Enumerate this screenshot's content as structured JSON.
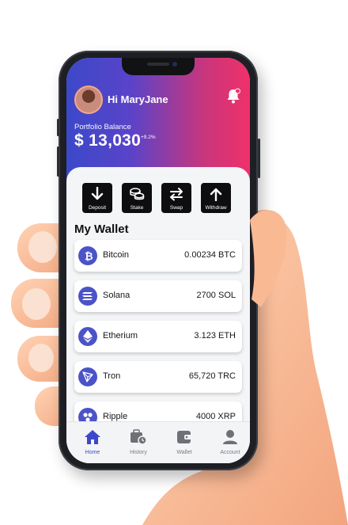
{
  "user": {
    "greeting": "Hi MaryJane"
  },
  "portfolio": {
    "label": "Portfolio Balance",
    "amount": "$ 13,030",
    "change": "+9.2%"
  },
  "actions": [
    {
      "label": "Deposit",
      "icon": "arrow-down-icon"
    },
    {
      "label": "Stake",
      "icon": "coin-stack-icon"
    },
    {
      "label": "Swap",
      "icon": "swap-arrows-icon"
    },
    {
      "label": "Withdraw",
      "icon": "arrow-up-icon"
    }
  ],
  "wallet": {
    "title": "My Wallet",
    "coins": [
      {
        "name": "Bitcoin",
        "amount": "0.00234 BTC",
        "icon": "bitcoin-icon"
      },
      {
        "name": "Solana",
        "amount": "2700 SOL",
        "icon": "solana-icon"
      },
      {
        "name": "Etherium",
        "amount": "3.123 ETH",
        "icon": "ethereum-icon"
      },
      {
        "name": "Tron",
        "amount": "65,720 TRC",
        "icon": "tron-icon"
      },
      {
        "name": "Ripple",
        "amount": "4000 XRP",
        "icon": "ripple-icon"
      }
    ]
  },
  "tabs": [
    {
      "label": "Home",
      "icon": "home-icon",
      "active": true
    },
    {
      "label": "History",
      "icon": "history-icon",
      "active": false
    },
    {
      "label": "Wallet",
      "icon": "wallet-icon",
      "active": false
    },
    {
      "label": "Account",
      "icon": "account-icon",
      "active": false
    }
  ],
  "colors": {
    "accent": "#3b49c9",
    "gradient_end": "#f0306a",
    "coin_icon_bg": "#4b53c8"
  }
}
